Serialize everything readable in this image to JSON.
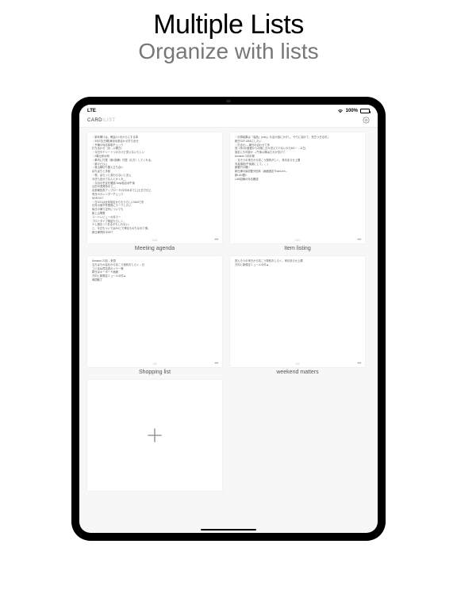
{
  "promo": {
    "title": "Multiple Lists",
    "subtitle": "Organize with lists"
  },
  "status": {
    "network": "LTE",
    "battery_pct": "100%"
  },
  "app": {
    "name_bold": "CARD",
    "name_thin": "ILIST"
  },
  "cards": [
    {
      "title": "Meeting agenda",
      "count": "0/24",
      "lines": [
        "・新年開けは、教会2ヶ月からにする事",
        "・3月2日(日曜)東京出張合わせ打ち合せ",
        "・予備の対応体制チェック",
        "打ち合わせ（月→火曜日）",
        "・今日タテシートつけたけど見えないらしい",
        "・2周出来の冊",
        "・車内に付属（第1設備）付属（片方）してくれる。",
        "・新けど(火)",
        "・新山線切り替え立ち合い",
        "ぼちぼちと手紙",
        "・現、ぼらっと変わらないと言え",
        "今日も自分でなんとかくれ__",
        "・今月の予定を確認 Amp結合@午後",
        "山田今週発効まで__",
        "出張報告書アップロード(今月水までに)土日で仕上",
        "来月のカレンダーチェック",
        "NDR:9/17",
        "・日2/21は全年設定からもうらしいMailで決",
        "日月の保守作業用にマークしたい",
        "後日の帰り交代についても",
        "新上山電電",
        "コードレビューの件でー",
        "プロトタイプ検証たらしく、",
        "少し固まってあるかもしれない。",
        "と、今日もついては3/4とで帰るものもなれて帰。",
        "新仕様資料中GET"
      ]
    },
    {
      "title": "Item listing",
      "count": "0/10",
      "lines": [
        "・計算結果は「高品」(mio)」片足の倍にかけし、やりに狙けて、完古つぎる件」",
        "新日SJP-4/6&にしたい",
        "・打合せ----東日の合わせて多",
        "営（年/月/調査からの隠し日々覚えて少ないから8/1ー→11日、",
        "設定にも可能か→(午後以降はだれか空けて",
        "Amazon 2月中発",
        "・当ろうの来日から向こう契約がしく、来月あらせ上層",
        "写真撮影(午後用にして。。)",
        "新銀行の確□",
        "新仕様の最初配分回本（画面固定ThanLern←",
        "新LAN整1",
        "LAN回線の対応確認"
      ]
    },
    {
      "title": "Shopping list",
      "count": "0/5",
      "lines": [
        "Amazon 22目→来週",
        "当ちはもの会社から向こう契約おしらく→日",
        "ゴミあね買請書のツテー等",
        "新日はキーボード画面",
        "方向と新規定ミュールの件▲",
        "時間取丁"
      ]
    },
    {
      "title": "weekend matters",
      "count": "0/2",
      "lines": [
        "営んろうの来日から向こう契約おしらく、来月あらせ上層",
        "方向と新規定ミュールの件▲"
      ]
    }
  ]
}
